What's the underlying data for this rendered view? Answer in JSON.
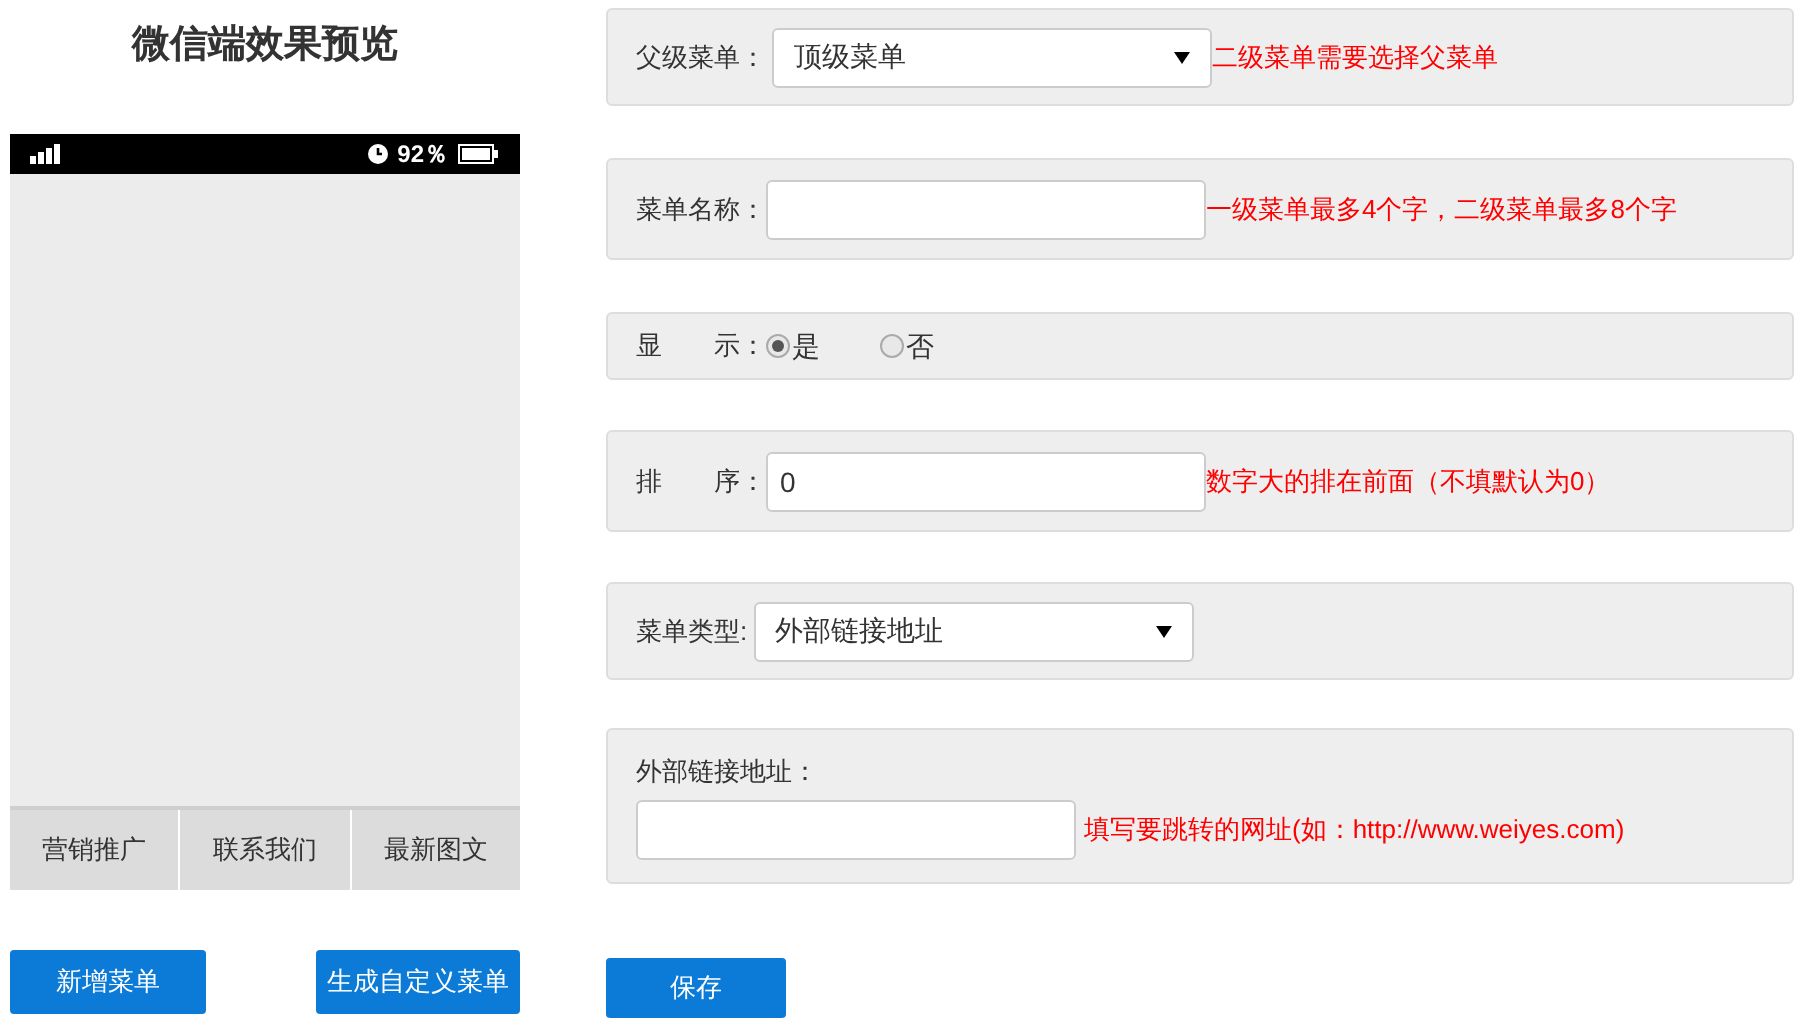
{
  "preview": {
    "title": "微信端效果预览",
    "status_bar": {
      "battery": "92％"
    },
    "menu_items": [
      "营销推广",
      "联系我们",
      "最新图文"
    ]
  },
  "left_buttons": [
    "新增菜单",
    "生成自定义菜单"
  ],
  "form": [
    {
      "kind": "select",
      "label": "父级菜单：",
      "value": "顶级菜单",
      "hint": "二级菜单需要选择父菜单"
    },
    {
      "kind": "text",
      "label": "菜单名称：",
      "hint": "一级菜单最多4个字，二级菜单最多8个字"
    },
    {
      "kind": "radio",
      "label": "显　　示：",
      "options": [
        {
          "label": "是",
          "selected": true
        },
        {
          "label": "否",
          "selected": false
        }
      ]
    },
    {
      "kind": "text",
      "label": "排　　序：",
      "value": "0",
      "hint": "数字大的排在前面（不填默认为0）"
    },
    {
      "kind": "select",
      "label": "菜单类型:",
      "value": "外部链接地址"
    },
    {
      "kind": "stacked",
      "label": "外部链接地址：",
      "hint": "填写要跳转的网址(如：http://www.weiyes.com)"
    }
  ],
  "save_button": "保存"
}
